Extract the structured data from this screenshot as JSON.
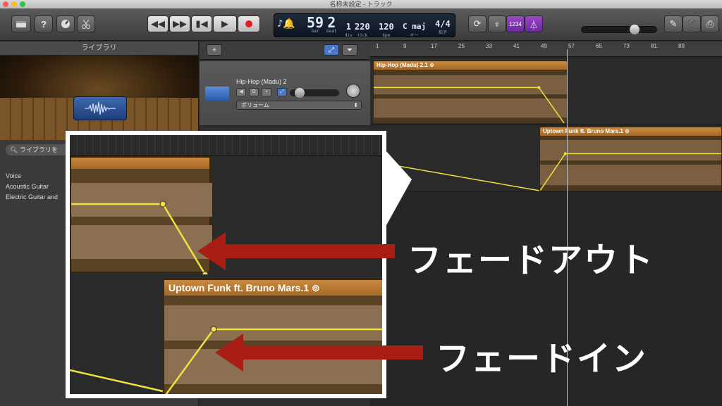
{
  "window": {
    "title": "名称未設定 - トラック"
  },
  "colors": {
    "region_orange": "#b8782f",
    "fade_line": "#f0e040",
    "arrow_red": "#a81e14",
    "lcd_bg": "#121a28"
  },
  "lcd": {
    "bar": "59",
    "bar_label": "bar",
    "beat": "2",
    "beat_label": "beat",
    "div": "1",
    "div_label": "div",
    "tick": "220",
    "tick_label": "tick",
    "tempo": "120",
    "tempo_label": "bpm",
    "key": "C maj",
    "key_label": "キー",
    "time_sig": "4/4",
    "time_sig_label": "拍子"
  },
  "toolbar": {
    "count_in": "1234",
    "master_volume_fraction": 0.72
  },
  "library": {
    "title": "ライブラリ",
    "search_placeholder": "ライブラリを",
    "items": [
      "Voice",
      "Acoustic Guitar",
      "Electric Guitar and"
    ]
  },
  "track": {
    "name": "Hip-Hop (Madu) 2",
    "automation_param": "ボリューム",
    "volume_fraction": 0.12
  },
  "ruler": {
    "ticks": [
      "1",
      "9",
      "17",
      "25",
      "33",
      "41",
      "49",
      "57",
      "65",
      "73",
      "81",
      "89"
    ]
  },
  "regions": [
    {
      "name": "Hip-Hop (Madu) 2.1"
    },
    {
      "name": "Uptown Funk ft. Bruno Mars.1"
    }
  ],
  "annotations": {
    "fade_out": "フェードアウト",
    "fade_in": "フェードイン"
  }
}
